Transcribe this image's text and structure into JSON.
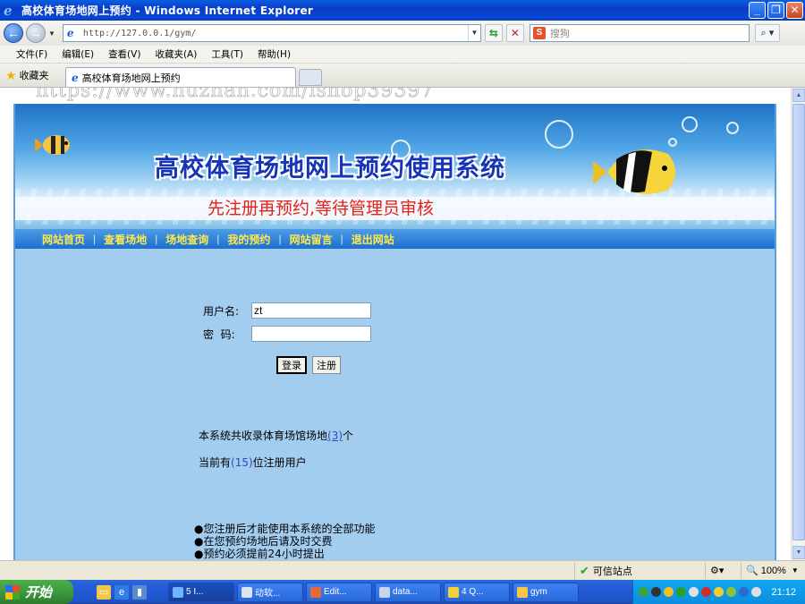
{
  "window": {
    "title": "高校体育场地网上预约 - Windows Internet Explorer"
  },
  "browser": {
    "url": "http://127.0.0.1/gym/",
    "search_placeholder": "搜狗",
    "menus": [
      "文件(F)",
      "编辑(E)",
      "查看(V)",
      "收藏夹(A)",
      "工具(T)",
      "帮助(H)"
    ],
    "favorites_label": "收藏夹",
    "tab_title": "高校体育场地网上预约",
    "watermark": "https://www.huzhan.com/ishop39397"
  },
  "site": {
    "title": "高校体育场地网上预约使用系统",
    "notice": "先注册再预约,等待管理员审核",
    "nav": [
      "网站首页",
      "查看场地",
      "场地查询",
      "我的预约",
      "网站留言",
      "退出网站"
    ],
    "login": {
      "username_label": "用户名:",
      "username_value": "zt",
      "password_label": "密  码:",
      "password_value": "",
      "login_button": "登录",
      "register_button": "注册"
    },
    "stats": {
      "venues_prefix": "本系统共收录体育场馆场地",
      "venues_count": "(3)",
      "venues_suffix": "个",
      "users_prefix": "当前有",
      "users_count": "(15)",
      "users_suffix": "位注册用户"
    },
    "notes": [
      "●您注册后才能使用本系统的全部功能",
      "●在您预约场地后请及时交费",
      "●预约必须提前24小时提出"
    ]
  },
  "statusbar": {
    "zone": "可信站点",
    "zoom": "100%"
  },
  "taskbar": {
    "start_label": "开始",
    "items": [
      "5 I...",
      "动软...",
      "Edit...",
      "data...",
      "4 Q...",
      "gym"
    ],
    "clock": "21:12"
  },
  "colors": {
    "title_bar": "#0a3cc8",
    "page_bg": "#a3cdef",
    "nav_text": "#ffe94a",
    "notice_text": "#e3221a",
    "site_title": "#1634b8"
  }
}
